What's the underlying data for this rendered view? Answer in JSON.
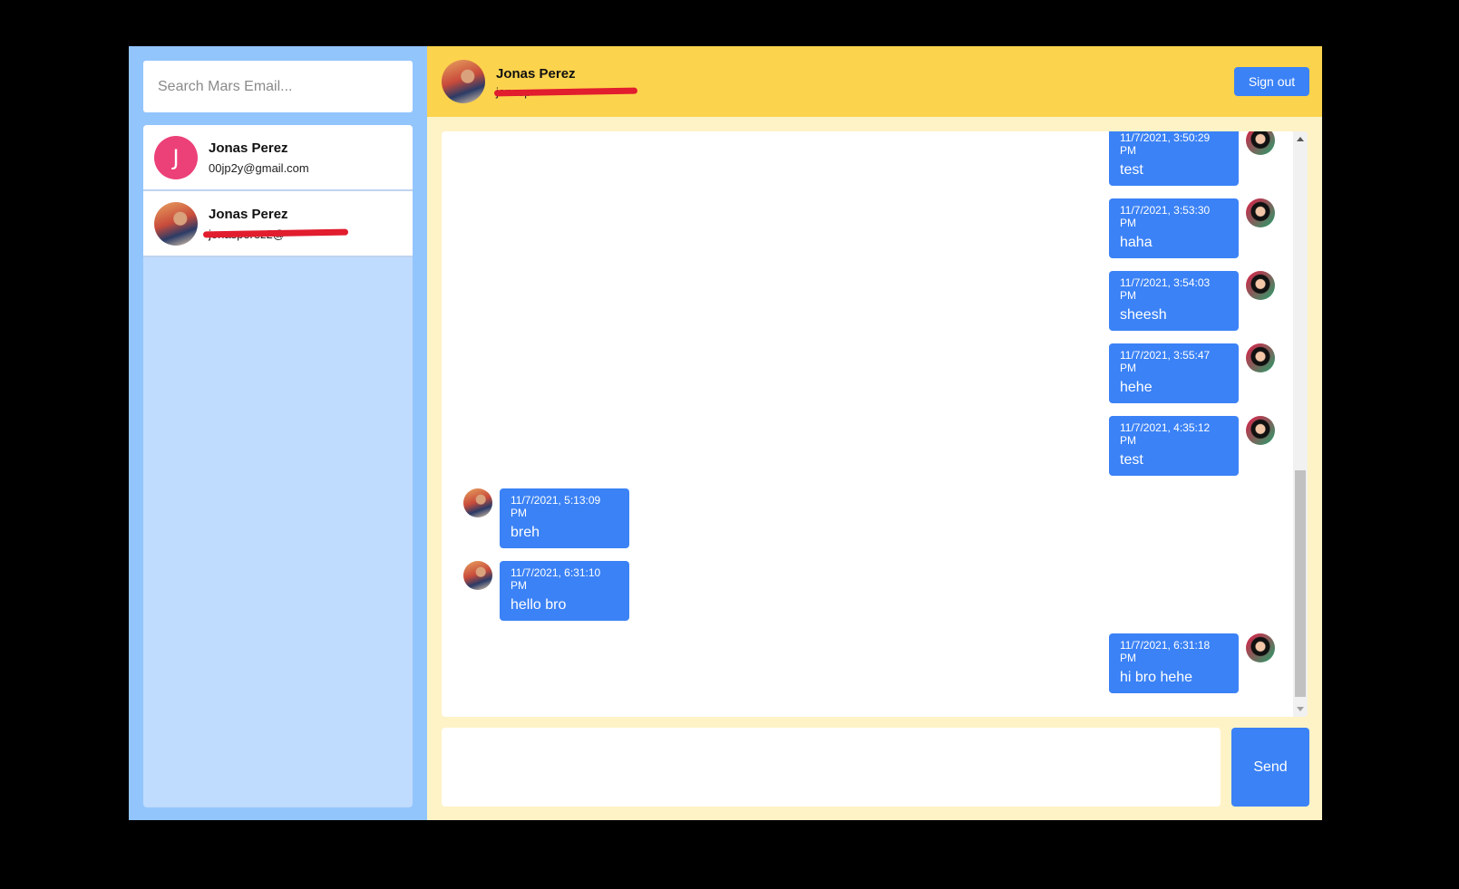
{
  "search": {
    "placeholder": "Search Mars Email..."
  },
  "contacts": [
    {
      "name": "Jonas Perez",
      "email": "00jp2y@gmail.com",
      "avatar_letter": "J",
      "avatar_color": "#ec4079"
    },
    {
      "name": "Jonas Perez",
      "email": "jonasperez2@",
      "avatar": "profile-photo"
    }
  ],
  "header": {
    "name": "Jonas Perez",
    "email": "jonasp",
    "signout_label": "Sign out"
  },
  "messages": [
    {
      "direction": "out",
      "time": "11/7/2021, 3:50:29 PM",
      "text": "test"
    },
    {
      "direction": "out",
      "time": "11/7/2021, 3:53:30 PM",
      "text": "haha"
    },
    {
      "direction": "out",
      "time": "11/7/2021, 3:54:03 PM",
      "text": "sheesh"
    },
    {
      "direction": "out",
      "time": "11/7/2021, 3:55:47 PM",
      "text": "hehe"
    },
    {
      "direction": "out",
      "time": "11/7/2021, 4:35:12 PM",
      "text": "test"
    },
    {
      "direction": "in",
      "time": "11/7/2021, 5:13:09 PM",
      "text": "breh"
    },
    {
      "direction": "in",
      "time": "11/7/2021, 6:31:10 PM",
      "text": "hello bro"
    },
    {
      "direction": "out",
      "time": "11/7/2021, 6:31:18 PM",
      "text": "hi bro hehe"
    }
  ],
  "composer": {
    "send_label": "Send"
  },
  "colors": {
    "primary": "#3b82f6",
    "header": "#fcd34d",
    "sidebar": "#93c5fd",
    "redaction": "#e11d2e"
  }
}
